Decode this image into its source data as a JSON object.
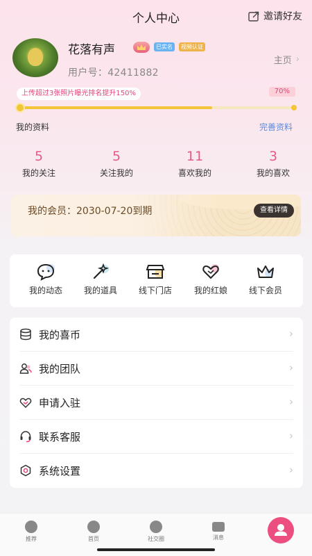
{
  "header": {
    "title": "个人中心",
    "invite_label": "邀请好友"
  },
  "profile": {
    "nickname": "花落有声",
    "badge_real": "已实名",
    "badge_video": "视频认证",
    "user_id": "用户号：42411882",
    "homepage": "主页",
    "tip": "上传超过3张照片曝光排名提升150%",
    "progress_label": "70%",
    "progress": 0.7,
    "my_profile": "我的资料",
    "complete_profile": "完善资料"
  },
  "stats": [
    {
      "value": "5",
      "label": "我的关注"
    },
    {
      "value": "5",
      "label": "关注我的"
    },
    {
      "value": "11",
      "label": "喜欢我的"
    },
    {
      "value": "3",
      "label": "我的喜欢"
    }
  ],
  "vip": {
    "text": "我的会员：2030-07-20到期",
    "button": "查看详情"
  },
  "tools": [
    {
      "label": "我的动态",
      "icon": "chat-bubble-icon"
    },
    {
      "label": "我的道具",
      "icon": "magic-wand-icon"
    },
    {
      "label": "线下门店",
      "icon": "store-icon"
    },
    {
      "label": "我的红娘",
      "icon": "hearts-icon"
    },
    {
      "label": "线下会员",
      "icon": "crown-icon"
    }
  ],
  "menu": [
    {
      "label": "我的喜币",
      "icon": "coins-icon"
    },
    {
      "label": "我的团队",
      "icon": "team-icon"
    },
    {
      "label": "申请入驻",
      "icon": "heart-handshake-icon"
    },
    {
      "label": "联系客服",
      "icon": "headset-icon"
    },
    {
      "label": "系统设置",
      "icon": "settings-icon"
    }
  ],
  "tabbar": [
    {
      "label": "推荐",
      "icon": "flame-icon"
    },
    {
      "label": "首页",
      "icon": "home-icon"
    },
    {
      "label": "社交圈",
      "icon": "gear-icon"
    },
    {
      "label": "消息",
      "icon": "mail-icon"
    },
    {
      "label": "",
      "icon": "user-icon"
    }
  ],
  "colors": {
    "accent": "#e45a86",
    "progress": "#f2c637",
    "link": "#5b8be0",
    "active_tab": "#ec4f7f"
  }
}
